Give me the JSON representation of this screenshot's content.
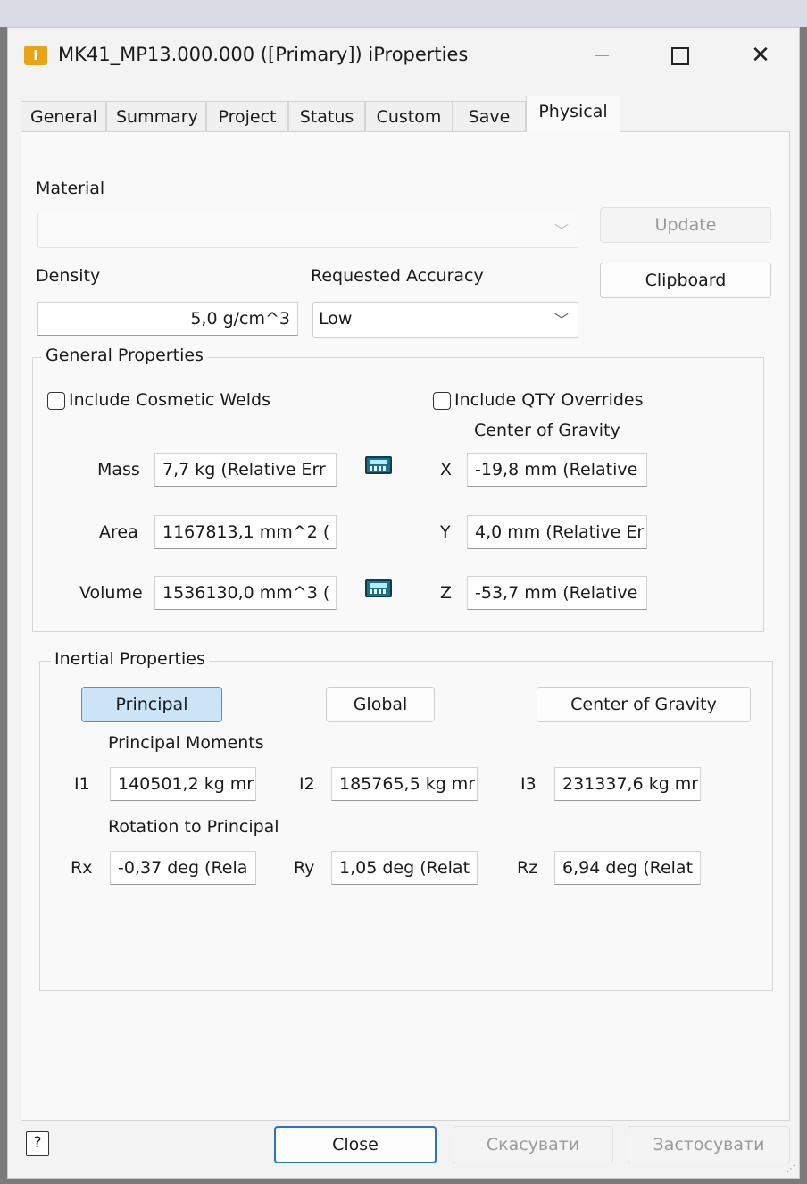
{
  "window": {
    "app_icon_letter": "I",
    "title": "MK41_MP13.000.000 ([Primary]) iProperties",
    "close_glyph": "✕"
  },
  "tabs": [
    "General",
    "Summary",
    "Project",
    "Status",
    "Custom",
    "Save",
    "Physical"
  ],
  "active_tab": "Physical",
  "material": {
    "label": "Material",
    "value": "",
    "update_label": "Update"
  },
  "density": {
    "label": "Density",
    "value": "5,0 g/cm^3"
  },
  "accuracy": {
    "label": "Requested Accuracy",
    "value": "Low"
  },
  "clipboard_label": "Clipboard",
  "general_properties": {
    "title": "General Properties",
    "cosmetic_welds_label": "Include Cosmetic Welds",
    "qty_overrides_label": "Include QTY Overrides",
    "cog_label": "Center of Gravity",
    "mass": {
      "label": "Mass",
      "value": "7,7 kg (Relative Err"
    },
    "area": {
      "label": "Area",
      "value": "1167813,1 mm^2 ("
    },
    "volume": {
      "label": "Volume",
      "value": "1536130,0 mm^3 ("
    },
    "x": {
      "label": "X",
      "value": "-19,8 mm (Relative"
    },
    "y": {
      "label": "Y",
      "value": "4,0 mm (Relative Er"
    },
    "z": {
      "label": "Z",
      "value": "-53,7 mm (Relative"
    }
  },
  "inertial_properties": {
    "title": "Inertial Properties",
    "principal_label": "Principal",
    "global_label": "Global",
    "cog_label": "Center of Gravity",
    "principal_moments_label": "Principal Moments",
    "i1": {
      "label": "I1",
      "value": "140501,2 kg mr"
    },
    "i2": {
      "label": "I2",
      "value": "185765,5 kg mr"
    },
    "i3": {
      "label": "I3",
      "value": "231337,6 kg mr"
    },
    "rotation_label": "Rotation to Principal",
    "rx": {
      "label": "Rx",
      "value": "-0,37 deg (Rela"
    },
    "ry": {
      "label": "Ry",
      "value": "1,05 deg (Relat"
    },
    "rz": {
      "label": "Rz",
      "value": "6,94 deg (Relat"
    }
  },
  "footer": {
    "help_glyph": "?",
    "close_label": "Close",
    "cancel_label": "Скасувати",
    "apply_label": "Застосувати"
  }
}
